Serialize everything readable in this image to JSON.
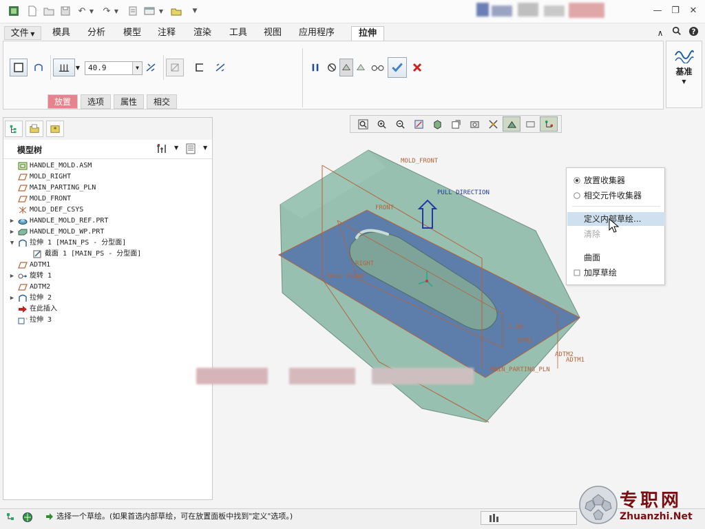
{
  "menus": [
    "文件",
    "模具",
    "分析",
    "模型",
    "注释",
    "渲染",
    "工具",
    "视图",
    "应用程序"
  ],
  "active_tab": "拉伸",
  "ribbon": {
    "depth_value": "40.9",
    "panel_tabs": [
      "放置",
      "选项",
      "属性",
      "相交"
    ],
    "datum_label": "基准"
  },
  "model_tree": {
    "title": "模型树",
    "items": [
      {
        "label": "HANDLE_MOLD.ASM",
        "icon": "assembly-icon",
        "expander": ""
      },
      {
        "label": "MOLD_RIGHT",
        "icon": "datum-plane-icon",
        "expander": ""
      },
      {
        "label": "MAIN_PARTING_PLN",
        "icon": "datum-plane-icon",
        "expander": ""
      },
      {
        "label": "MOLD_FRONT",
        "icon": "datum-plane-icon",
        "expander": ""
      },
      {
        "label": "MOLD_DEF_CSYS",
        "icon": "csys-icon",
        "expander": ""
      },
      {
        "label": "HANDLE_MOLD_REF.PRT",
        "icon": "ref-part-icon",
        "expander": "▶"
      },
      {
        "label": "HANDLE_MOLD_WP.PRT",
        "icon": "workpiece-icon",
        "expander": "▶"
      },
      {
        "label": "拉伸 1 [MAIN_PS - 分型面]",
        "icon": "extrude-icon",
        "expander": "▼"
      },
      {
        "label": "截面 1 [MAIN_PS - 分型面]",
        "icon": "sketch-icon",
        "expander": ""
      },
      {
        "label": "ADTM1",
        "icon": "datum-plane-icon",
        "expander": ""
      },
      {
        "label": "旋转 1",
        "icon": "revolve-icon",
        "expander": "▶"
      },
      {
        "label": "ADTM2",
        "icon": "datum-plane-icon",
        "expander": ""
      },
      {
        "label": "拉伸 2",
        "icon": "extrude-icon",
        "expander": "▶"
      },
      {
        "label": "在此插入",
        "icon": "insert-arrow-icon",
        "expander": ""
      },
      {
        "label": "拉伸 3",
        "icon": "extrude-active-icon",
        "expander": ""
      }
    ]
  },
  "model_labels": {
    "mold_front": "MOLD_FRONT",
    "pull_direction": "PULL DIRECTION",
    "front": "FRONT",
    "right": "RIGHT",
    "mold_right": "MOLD_RIGHT",
    "adtm2": "ADTM2",
    "adtm1": "ADTM1",
    "main_parting_pln": "MAIN_PARTING_PLN",
    "dtm": "DTM2",
    "dim": "1.00"
  },
  "context_menu": {
    "placement_collector": "放置收集器",
    "intersect_collector": "相交元件收集器",
    "define_internal_sketch": "定义内部草绘...",
    "clear": "清除",
    "surface": "曲面",
    "thicken_sketch": "加厚草绘"
  },
  "status": {
    "message": "选择一个草绘。(如果首选内部草绘，可在放置面板中找到\"定义\"选项。)"
  },
  "watermark": {
    "cn": "专职网",
    "en": "Zhuanzhi.Net"
  },
  "colors": {
    "accent": "#e8828c",
    "mold_green": "#86b6a4",
    "parting_blue": "#4d6aa8",
    "label_orange": "#b6633a",
    "watermark_red": "#7a0f12"
  }
}
